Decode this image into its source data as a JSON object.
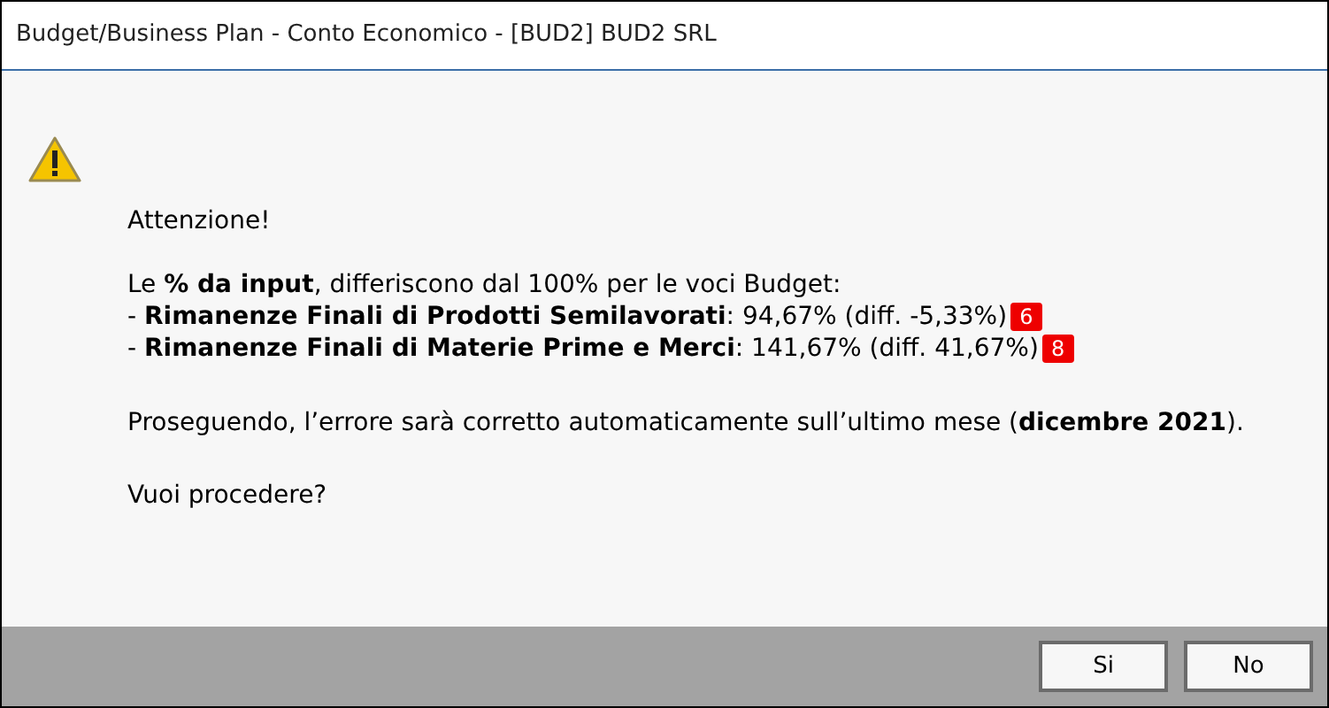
{
  "window": {
    "title": "Budget/Business Plan - Conto Economico - [BUD2] BUD2 SRL"
  },
  "message": {
    "heading": "Attenzione!",
    "intro": "Le **% da input**, differiscono dal 100% per le voci Budget:",
    "items": [
      {
        "text": "- **Rimanenze Finali di Prodotti Semilavorati**: 94,67% (diff. -5,33%)",
        "badge": "6"
      },
      {
        "text": "- **Rimanenze Finali di Materie Prime e Merci**: 141,67% (diff. 41,67%)",
        "badge": "8"
      }
    ],
    "note": "Proseguendo, l’errore sarà corretto automaticamente sull’ultimo mese (**dicembre 2021**).",
    "question": "Vuoi procedere?"
  },
  "buttons": [
    "Si",
    "No"
  ]
}
